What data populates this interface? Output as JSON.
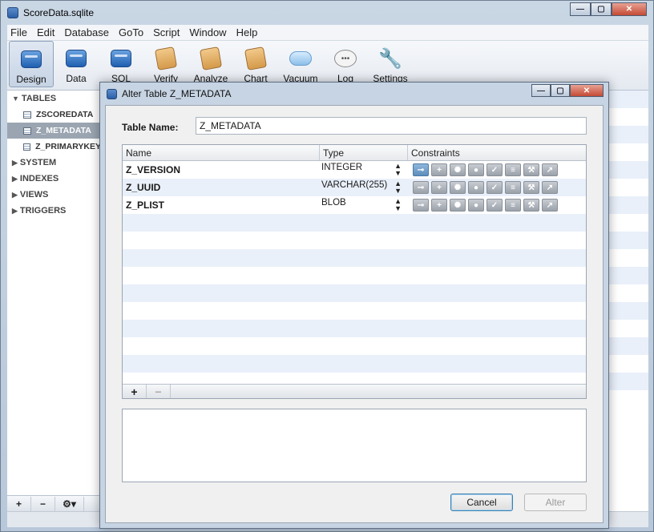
{
  "window": {
    "title": "ScoreData.sqlite"
  },
  "menu": [
    "File",
    "Edit",
    "Database",
    "GoTo",
    "Script",
    "Window",
    "Help"
  ],
  "toolbar": [
    {
      "label": "Design",
      "icon": "design-icon",
      "active": true
    },
    {
      "label": "Data",
      "icon": "data-icon"
    },
    {
      "label": "SQL",
      "icon": "sql-icon"
    },
    {
      "label": "Verify",
      "icon": "verify-icon"
    },
    {
      "label": "Analyze",
      "icon": "analyze-icon"
    },
    {
      "label": "Chart",
      "icon": "chart-icon"
    },
    {
      "label": "Vacuum",
      "icon": "vacuum-icon"
    },
    {
      "label": "Log",
      "icon": "log-icon"
    },
    {
      "label": "Settings",
      "icon": "settings-icon"
    }
  ],
  "sidebar": {
    "tables_label": "TABLES",
    "tables": [
      "ZSCOREDATA",
      "Z_METADATA",
      "Z_PRIMARYKEY"
    ],
    "selected": "Z_METADATA",
    "groups": [
      "SYSTEM",
      "INDEXES",
      "VIEWS",
      "TRIGGERS"
    ]
  },
  "dialog": {
    "title": "Alter Table Z_METADATA",
    "table_name_label": "Table Name:",
    "table_name_value": "Z_METADATA",
    "columns_header": {
      "name": "Name",
      "type": "Type",
      "constraints": "Constraints"
    },
    "columns": [
      {
        "name": "Z_VERSION",
        "type": "INTEGER"
      },
      {
        "name": "Z_UUID",
        "type": "VARCHAR(255)"
      },
      {
        "name": "Z_PLIST",
        "type": "BLOB"
      }
    ],
    "add_symbol": "+",
    "remove_symbol": "−",
    "cancel_label": "Cancel",
    "alter_label": "Alter"
  },
  "colors": {
    "accent": "#5d8dbb",
    "selection": "#9aa5b1",
    "row_stripe": "#e9f0fa"
  }
}
